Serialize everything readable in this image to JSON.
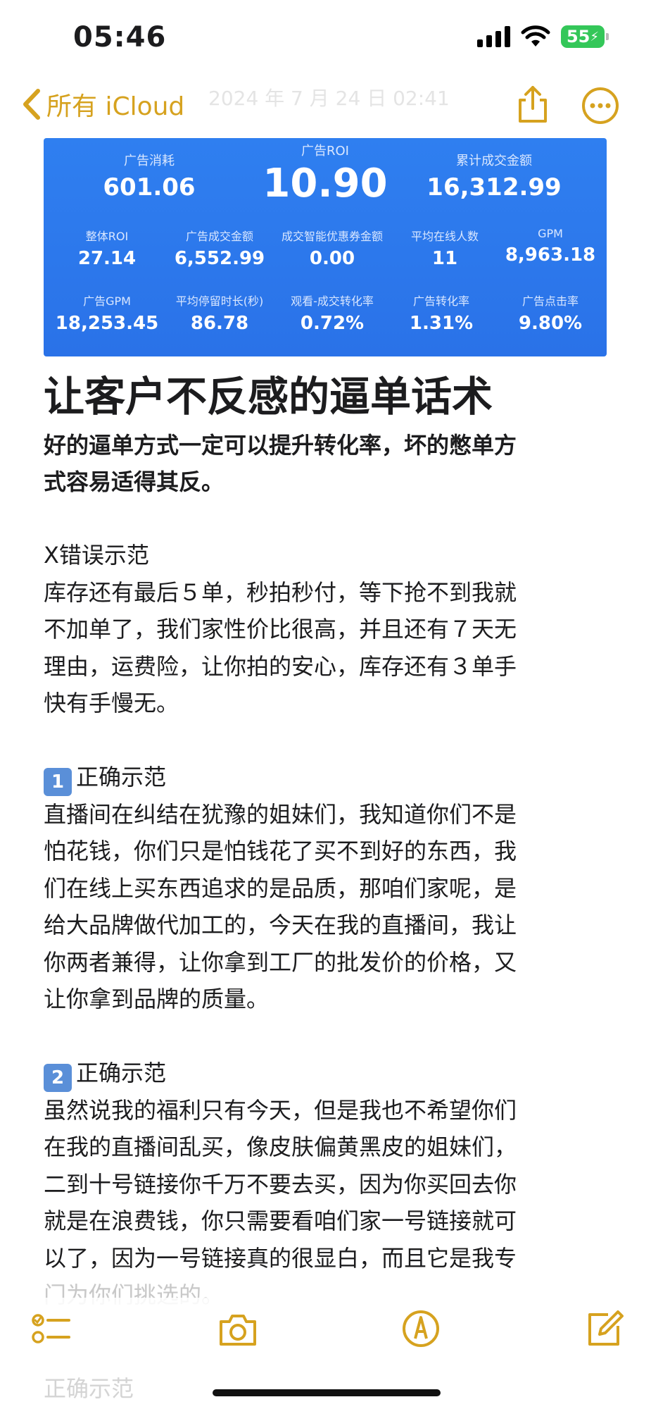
{
  "status": {
    "time": "05:46",
    "battery": "55"
  },
  "nav": {
    "back_label": "所有 iCloud",
    "watermark": "2024 年 7 月 24 日 02:41"
  },
  "dashboard": {
    "top": [
      {
        "label": "广告消耗",
        "value": "601.06"
      },
      {
        "label": "广告ROI",
        "value": "10.90"
      },
      {
        "label": "累计成交金额",
        "value": "16,312.99"
      }
    ],
    "row2": [
      {
        "label": "整体ROI",
        "value": "27.14"
      },
      {
        "label": "广告成交金额",
        "value": "6,552.99"
      },
      {
        "label": "成交智能优惠券金额",
        "value": "0.00"
      },
      {
        "label": "平均在线人数",
        "value": "11"
      },
      {
        "label": "GPM",
        "value": "8,963.18"
      }
    ],
    "row3": [
      {
        "label": "广告GPM",
        "value": "18,253.45"
      },
      {
        "label": "平均停留时长(秒)",
        "value": "86.78"
      },
      {
        "label": "观看-成交转化率",
        "value": "0.72%"
      },
      {
        "label": "广告转化率",
        "value": "1.31%"
      },
      {
        "label": "广告点击率",
        "value": "9.80%"
      }
    ]
  },
  "note": {
    "title": "让客户不反感的逼单话术",
    "subtitle_l1": "好的逼单方式一定可以提升转化率，坏的憋单方",
    "subtitle_l2": "式容易适得其反。",
    "wrong_heading": "X错误示范",
    "wrong_l1": "库存还有最后５单，秒拍秒付，等下抢不到我就",
    "wrong_l2": "不加单了，我们家性价比很高，并且还有７天无",
    "wrong_l3": "理由，运费险，让你拍的安心，库存还有３单手",
    "wrong_l4": "快有手慢无。",
    "badge1": "1",
    "correct_heading": "正确示范",
    "c1_l1": "直播间在纠结在犹豫的姐妹们，我知道你们不是",
    "c1_l2": "怕花钱，你们只是怕钱花了买不到好的东西，我",
    "c1_l3": "们在线上买东西追求的是品质，那咱们家呢，是",
    "c1_l4": "给大品牌做代加工的，今天在我的直播间，我让",
    "c1_l5": "你两者兼得，让你拿到工厂的批发价的价格，又",
    "c1_l6": "让你拿到品牌的质量。",
    "badge2": "2",
    "c2_l1": "虽然说我的福利只有今天，但是我也不希望你们",
    "c2_l2": "在我的直播间乱买，像皮肤偏黄黑皮的姐妹们，",
    "c2_l3": "二到十号链接你千万不要去买，因为你买回去你",
    "c2_l4": "就是在浪费钱，你只需要看咱们家一号链接就可",
    "c2_l5": "以了，因为一号链接真的很显白，而且它是我专",
    "c2_l6": "门为你们挑选的。",
    "c3_heading": "正确示范"
  }
}
